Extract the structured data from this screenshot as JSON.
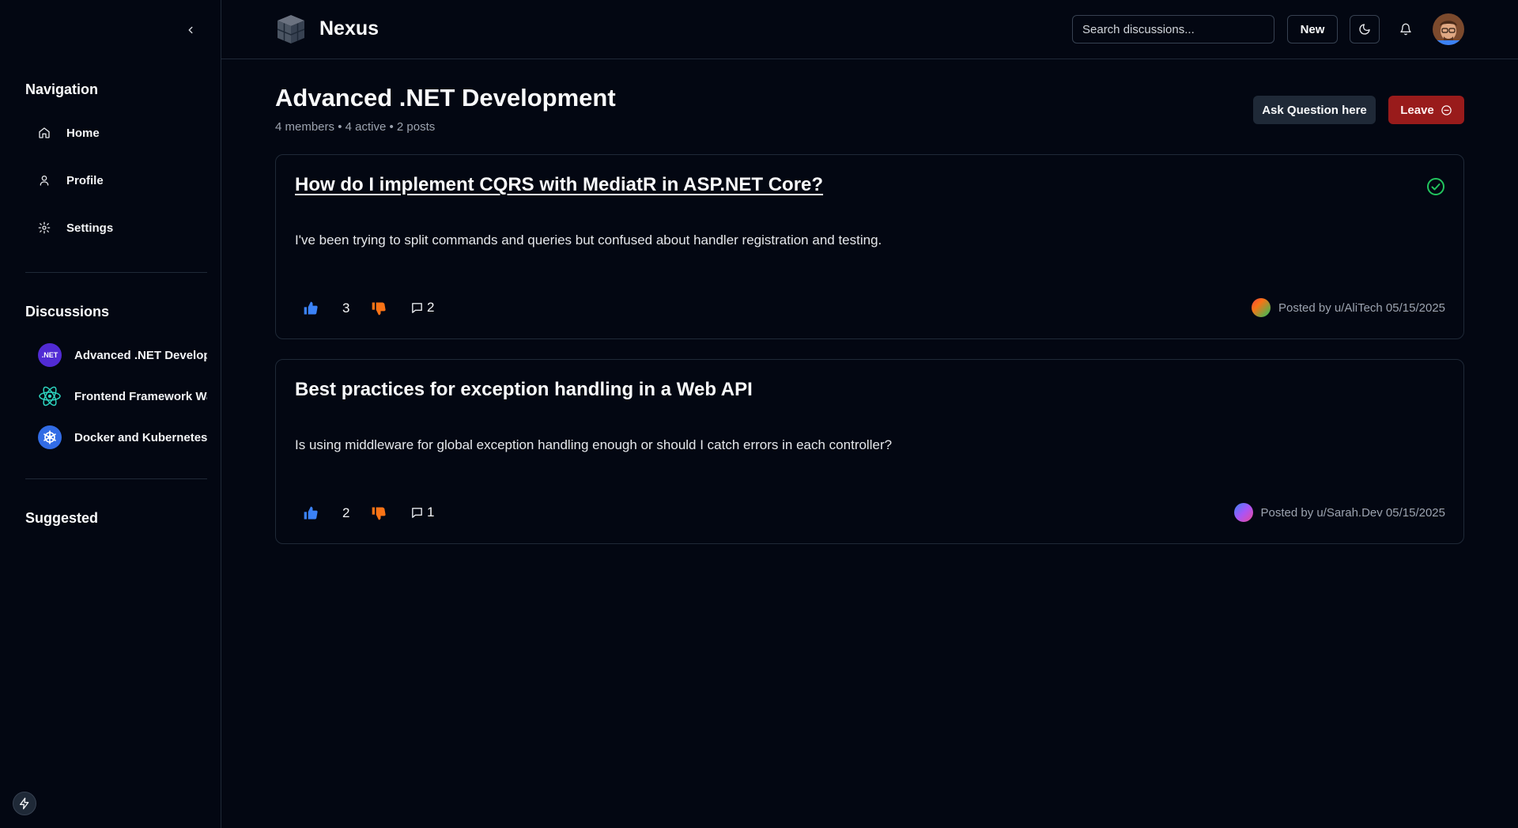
{
  "app": {
    "brand": "Nexus"
  },
  "sidebar": {
    "navigation_heading": "Navigation",
    "nav_items": [
      {
        "label": "Home",
        "icon": "home-icon"
      },
      {
        "label": "Profile",
        "icon": "user-icon"
      },
      {
        "label": "Settings",
        "icon": "gear-icon"
      }
    ],
    "discussions_heading": "Discussions",
    "discussions": [
      {
        "label": "Advanced .NET Development",
        "icon_text": ".NET",
        "icon": "dotnet-icon"
      },
      {
        "label": "Frontend Framework Wars",
        "icon": "react-icon"
      },
      {
        "label": "Docker and Kubernetes",
        "icon": "kubernetes-icon"
      }
    ],
    "suggested_heading": "Suggested"
  },
  "header": {
    "search_placeholder": "Search discussions...",
    "new_label": "New"
  },
  "community": {
    "title": "Advanced .NET Development",
    "meta": "4 members • 4 active • 2 posts",
    "ask_label": "Ask Question here",
    "leave_label": "Leave"
  },
  "posts": [
    {
      "title": "How do I implement CQRS with MediatR in ASP.NET Core?",
      "body": "I've been trying to split commands and queries but confused about handler registration and testing.",
      "votes": "3",
      "comments": "2",
      "posted": "Posted by u/AliTech 05/15/2025",
      "solved": true
    },
    {
      "title": "Best practices for exception handling in a Web API",
      "body": "Is using middleware for global exception handling enough or should I catch errors in each controller?",
      "votes": "2",
      "comments": "1",
      "posted": "Posted by u/Sarah.Dev 05/15/2025",
      "solved": false
    }
  ],
  "colors": {
    "background": "#030712",
    "border": "#1f2937",
    "upvote": "#3b82f6",
    "downvote": "#f97316",
    "leave": "#991b1b",
    "solved": "#22c55e"
  }
}
